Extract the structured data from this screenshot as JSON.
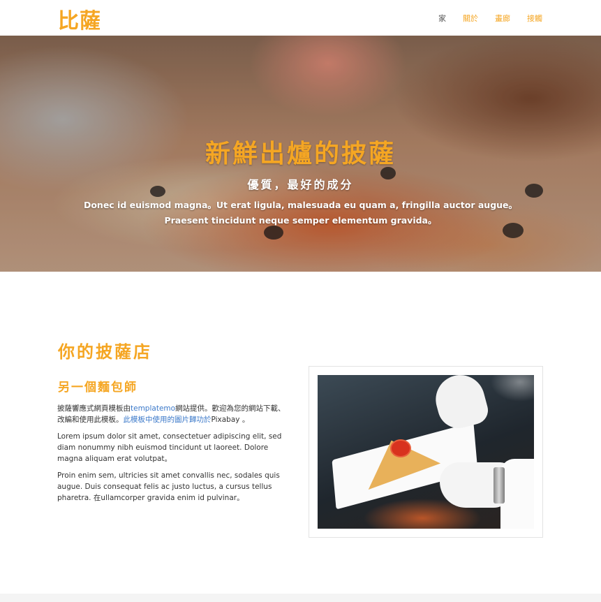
{
  "header": {
    "logo": "比薩",
    "nav": [
      {
        "label": "家",
        "active": true
      },
      {
        "label": "關於",
        "active": false
      },
      {
        "label": "畫廊",
        "active": false
      },
      {
        "label": "接觸",
        "active": false
      }
    ]
  },
  "hero": {
    "title": "新鮮出爐的披薩",
    "subtitle": "優質，最好的成分",
    "desc_line1": "Donec id euismod magna。Ut erat ligula, malesuada eu quam a, fringilla auctor augue。",
    "desc_line2": "Praesent tincidunt neque semper elementum gravida。"
  },
  "content": {
    "title": "你的披薩店",
    "subtitle": "另一個麵包師",
    "p1_a": "披薩響應式網頁模板由",
    "p1_link1": "templatemo",
    "p1_b": "網站提供。歡迎為您的網站下載、改編和使用此模板。",
    "p1_link2": "此模板中使用的圖片歸功於",
    "p1_c": "Pixabay 。",
    "p2": "Lorem ipsum dolor sit amet, consectetuer adipiscing elit, sed diam nonummy nibh euismod tincidunt ut laoreet. Dolore magna aliquam erat volutpat。",
    "p3": "Proin enim sem, ultricies sit amet convallis nec, sodales quis augue. Duis consequat felis ac justo luctus, a cursus tellus pharetra. 在ullamcorper gravida enim id pulvinar。"
  },
  "colors": {
    "accent": "#f5a623",
    "link": "#3a78c9",
    "text": "#333333"
  }
}
